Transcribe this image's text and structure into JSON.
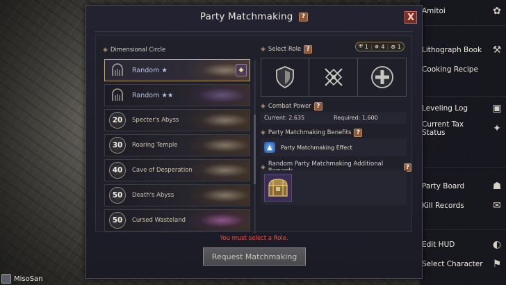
{
  "player": {
    "name": "MisoSan"
  },
  "side_menu": {
    "items": [
      {
        "label": "Amitoi",
        "icon": "amitoi-icon"
      },
      {
        "label": "Lithograph Book",
        "icon": "lithograph-icon"
      },
      {
        "label": "Cooking Recipe",
        "icon": ""
      },
      {
        "label": "Leveling Log",
        "icon": "leveling-log-icon"
      },
      {
        "label": "Current Tax Status",
        "icon": "tax-status-icon"
      },
      {
        "label": "Party Board",
        "icon": "party-board-icon"
      },
      {
        "label": "Kill Records",
        "icon": "kill-records-icon"
      },
      {
        "label": "Edit HUD",
        "icon": "edit-hud-icon"
      },
      {
        "label": "Select Character",
        "icon": "select-character-icon"
      }
    ]
  },
  "dialog": {
    "title": "Party Matchmaking",
    "help": "?",
    "close": "X",
    "left_header": "Dimensional Circle",
    "dungeons": [
      {
        "level": "",
        "name": "Random ★",
        "kind": "random",
        "locked": true
      },
      {
        "level": "",
        "name": "Random ★★",
        "kind": "random",
        "locked": false
      },
      {
        "level": "20",
        "name": "Specter's Abyss",
        "kind": "dungeon"
      },
      {
        "level": "30",
        "name": "Roaring Temple",
        "kind": "dungeon"
      },
      {
        "level": "40",
        "name": "Cave of Desperation",
        "kind": "dungeon"
      },
      {
        "level": "50",
        "name": "Death's Abyss",
        "kind": "dungeon"
      },
      {
        "level": "50",
        "name": "Cursed Wasteland",
        "kind": "dungeon"
      }
    ],
    "select_role": {
      "label": "Select Role",
      "counts": {
        "tank": "1",
        "damage": "4",
        "healer": "1"
      },
      "roles": [
        "tank-role",
        "damage-role",
        "healer-role"
      ]
    },
    "combat_power": {
      "label": "Combat Power",
      "current_label": "Current: 2,635",
      "required_label": "Required: 1,600"
    },
    "benefits": {
      "label": "Party Matchmaking Benefits",
      "effect": "Party Matchmaking Effect"
    },
    "rewards": {
      "label": "Random Party Matchmaking Additional Rewards"
    },
    "warning": "You must select a Role.",
    "request_button": "Request Matchmaking"
  },
  "colors": {
    "panel_bg": "#1f1f29",
    "accent_gold": "#c6a878",
    "warning_red": "#e0574c",
    "close_red": "#7a2b25"
  }
}
